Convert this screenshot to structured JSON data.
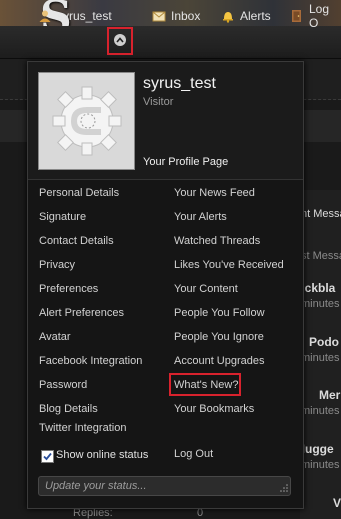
{
  "colors": {
    "highlight": "#d8222d",
    "menu_bg": "#151515",
    "bar_bg": "#252525"
  },
  "header": {
    "logo_letter": "S"
  },
  "visitor_bar": {
    "username": "syrus_test",
    "inbox_label": "Inbox",
    "alerts_label": "Alerts",
    "logout_label": "Log O",
    "icons": [
      "user-icon",
      "chevron-up-icon",
      "inbox-icon",
      "bell-icon",
      "door-icon"
    ]
  },
  "background_page": {
    "right_snippets": [
      "nt Messa",
      "st Messa",
      "uickbla",
      "minutes",
      "Podo",
      "minutes",
      "Mer",
      "minutes",
      "dNugge",
      "minutes",
      "V"
    ],
    "bottom_left": [
      "Replies:",
      "0"
    ]
  },
  "menu": {
    "username": "syrus_test",
    "user_title": "Visitor",
    "profile_link": "Your Profile Page",
    "left_column": [
      "Personal Details",
      "Signature",
      "Contact Details",
      "Privacy",
      "Preferences",
      "Alert Preferences",
      "Avatar",
      "Facebook Integration",
      "Password",
      "Blog Details",
      "Twitter Integration"
    ],
    "right_column": [
      "Your News Feed",
      "Your Alerts",
      "Watched Threads",
      "Likes You've Received",
      "Your Content",
      "People You Follow",
      "People You Ignore",
      "Account Upgrades",
      "What's New?",
      "Your Bookmarks"
    ],
    "show_online_status": "Show online status",
    "show_online_checked": true,
    "logout": "Log Out",
    "status_placeholder": "Update your status..."
  }
}
